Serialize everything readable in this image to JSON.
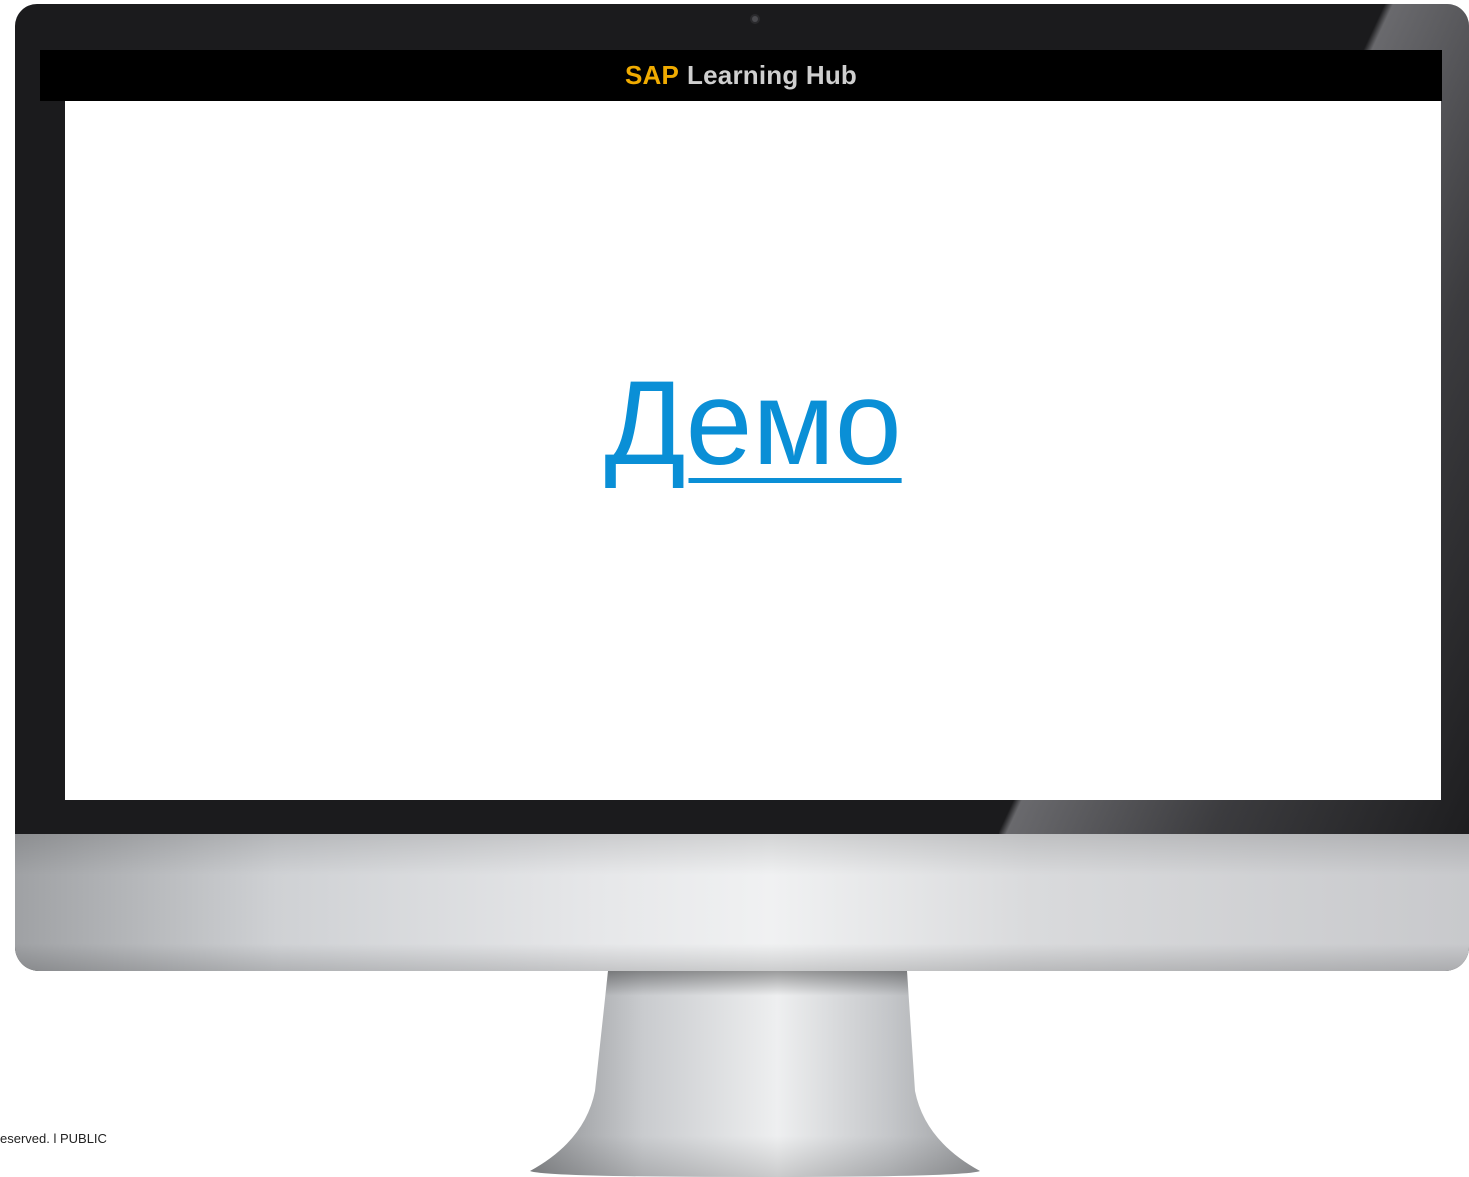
{
  "header": {
    "brand": "SAP",
    "product": "Learning Hub"
  },
  "main": {
    "link_label": "Демо"
  },
  "footer": {
    "text": "eserved.  l   PUBLIC"
  },
  "colors": {
    "brand_accent": "#f0ab00",
    "link": "#0a8fd6",
    "titlebar_bg": "#000000"
  }
}
